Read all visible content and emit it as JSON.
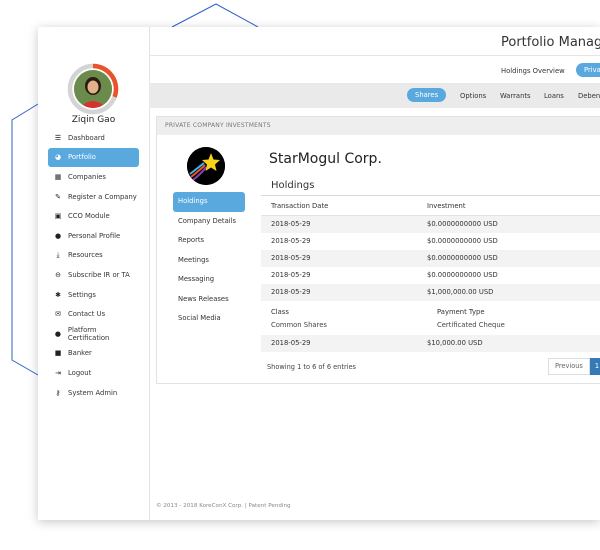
{
  "user": {
    "name": "Ziqin Gao"
  },
  "nav": [
    {
      "label": "Dashboard",
      "icon": "list-icon",
      "active": false
    },
    {
      "label": "Portfolio",
      "icon": "pie-chart-icon",
      "active": true
    },
    {
      "label": "Companies",
      "icon": "building-icon",
      "active": false
    },
    {
      "label": "Register a Company",
      "icon": "edit-icon",
      "active": false
    },
    {
      "label": "CCO Module",
      "icon": "cco-icon",
      "active": false
    },
    {
      "label": "Personal Profile",
      "icon": "user-icon",
      "active": false
    },
    {
      "label": "Resources",
      "icon": "download-icon",
      "active": false
    },
    {
      "label": "Subscribe IR or TA",
      "icon": "subscribe-icon",
      "active": false
    },
    {
      "label": "Settings",
      "icon": "gear-icon",
      "active": false
    },
    {
      "label": "Contact Us",
      "icon": "envelope-icon",
      "active": false
    },
    {
      "label": "Platform Certification",
      "icon": "certificate-icon",
      "active": false
    },
    {
      "label": "Banker",
      "icon": "bank-icon",
      "active": false
    },
    {
      "label": "Logout",
      "icon": "logout-icon",
      "active": false
    },
    {
      "label": "System Admin",
      "icon": "key-icon",
      "active": false
    }
  ],
  "header": {
    "title": "Portfolio Manage"
  },
  "tabs_top": {
    "overview": "Holdings Overview",
    "private": "Priva"
  },
  "tabs_sec": {
    "shares": "Shares",
    "options": "Options",
    "warrants": "Warrants",
    "loans": "Loans",
    "debentures": "Deben"
  },
  "panel": {
    "heading": "PRIVATE COMPANY INVESTMENTS",
    "company": "StarMogul Corp.",
    "section": "Holdings",
    "sub_nav": [
      {
        "label": "Holdings",
        "active": true
      },
      {
        "label": "Company Details",
        "active": false
      },
      {
        "label": "Reports",
        "active": false
      },
      {
        "label": "Meetings",
        "active": false
      },
      {
        "label": "Messaging",
        "active": false
      },
      {
        "label": "News Releases",
        "active": false
      },
      {
        "label": "Social Media",
        "active": false
      }
    ],
    "columns": {
      "date": "Transaction Date",
      "investment": "Investment"
    },
    "rows": [
      {
        "date": "2018-05-29",
        "investment": "$0.0000000000 USD"
      },
      {
        "date": "2018-05-29",
        "investment": "$0.0000000000 USD"
      },
      {
        "date": "2018-05-29",
        "investment": "$0.0000000000 USD"
      },
      {
        "date": "2018-05-29",
        "investment": "$0.0000000000 USD"
      },
      {
        "date": "2018-05-29",
        "investment": "$1,000,000.00 USD"
      }
    ],
    "detail": {
      "class_label": "Class",
      "class_value": "Common Shares",
      "payment_label": "Payment Type",
      "payment_value": "Certificated Cheque"
    },
    "last_row": {
      "date": "2018-05-29",
      "investment": "$10,000.00 USD"
    },
    "info": "Showing 1 to 6 of 6 entries",
    "pager": {
      "previous": "Previous",
      "page": "1"
    }
  },
  "footer": "© 2013 - 2018 KoreConX Corp. | Patent Pending",
  "colors": {
    "accent": "#5aa9de",
    "deco_line": "#2f63c8",
    "page_active": "#337ab7"
  }
}
